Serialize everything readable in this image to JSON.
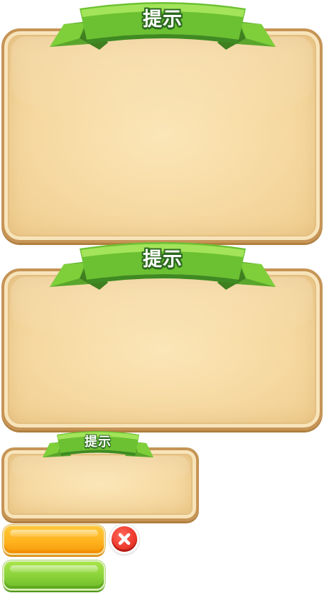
{
  "dialog_large_1": {
    "title": "提示"
  },
  "dialog_large_2": {
    "title": "提示"
  },
  "dialog_small": {
    "title": "提示"
  },
  "buttons": {
    "orange": {
      "label": "",
      "color": "#ffb41e"
    },
    "green": {
      "label": "",
      "color": "#8ad23a"
    },
    "close": {
      "icon": "close-icon",
      "color": "#ee3b2e"
    }
  },
  "colors": {
    "panel_fill": "#f6d9a1",
    "panel_border": "#c69456",
    "ribbon_green": "#7fcf3a",
    "ribbon_dark": "#4e9a2a"
  }
}
